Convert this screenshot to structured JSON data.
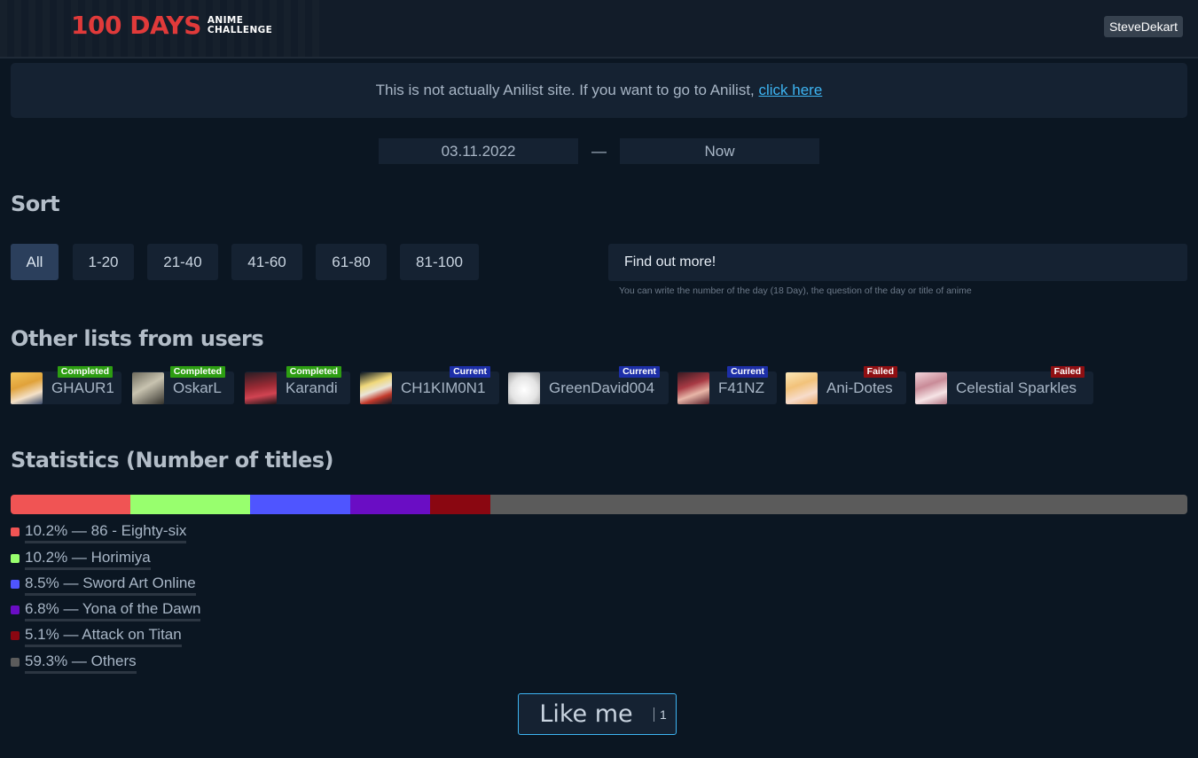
{
  "header": {
    "logo_big": "100 DAYS",
    "logo_line1": "ANIME",
    "logo_line2": "CHALLENGE",
    "username": "SteveDekart"
  },
  "notice": {
    "text": "This is not actually Anilist site. If you want to go to Anilist, ",
    "link_label": "click here"
  },
  "date_range": {
    "start": "03.11.2022",
    "separator": "—",
    "end": "Now"
  },
  "sort": {
    "title": "Sort",
    "buttons": [
      "All",
      "1-20",
      "21-40",
      "41-60",
      "61-80",
      "81-100"
    ],
    "active": "All"
  },
  "search": {
    "placeholder": "Find out more!",
    "hint": "You can write the number of the day (18 Day), the question of the day or title of anime"
  },
  "other_lists": {
    "title": "Other lists from users",
    "users": [
      {
        "name": "GHAUR1",
        "status": "Completed"
      },
      {
        "name": "OskarL",
        "status": "Completed"
      },
      {
        "name": "Karandi",
        "status": "Completed"
      },
      {
        "name": "CH1KIM0N1",
        "status": "Current"
      },
      {
        "name": "GreenDavid004",
        "status": "Current"
      },
      {
        "name": "F41NZ",
        "status": "Current"
      },
      {
        "name": "Ani-Dotes",
        "status": "Failed"
      },
      {
        "name": "Celestial Sparkles",
        "status": "Failed"
      }
    ]
  },
  "statistics": {
    "title": "Statistics (Number of titles)",
    "items": [
      {
        "label": "10.2% — 86 - Eighty-six",
        "percent": 10.2,
        "color": "#f05454"
      },
      {
        "label": "10.2% — Horimiya",
        "percent": 10.2,
        "color": "#98ff6e"
      },
      {
        "label": "8.5% — Sword Art Online",
        "percent": 8.5,
        "color": "#4f55ff"
      },
      {
        "label": "6.8% — Yona of the Dawn",
        "percent": 6.8,
        "color": "#6a0dc4"
      },
      {
        "label": "5.1% — Attack on Titan",
        "percent": 5.1,
        "color": "#8a0711"
      },
      {
        "label": "59.3% — Others",
        "percent": 59.3,
        "color": "#5b5b5b"
      }
    ]
  },
  "like": {
    "label": "Like me",
    "count": "1"
  }
}
